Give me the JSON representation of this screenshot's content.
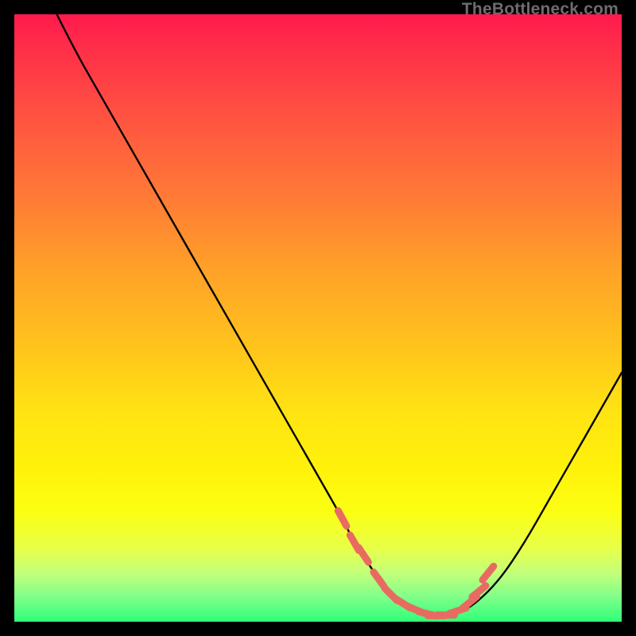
{
  "watermark": "TheBottleneck.com",
  "colors": {
    "curve": "#000000",
    "marker": "#e86b62",
    "background_top": "#ff1a4d",
    "background_bottom": "#2eff77",
    "frame": "#000000"
  },
  "chart_data": {
    "type": "line",
    "title": "",
    "xlabel": "",
    "ylabel": "",
    "xlim": [
      0,
      100
    ],
    "ylim": [
      0,
      100
    ],
    "grid": false,
    "series": [
      {
        "name": "bottleneck-curve",
        "x": [
          7,
          10,
          14,
          18,
          22,
          26,
          30,
          34,
          38,
          42,
          46,
          50,
          54,
          56,
          58,
          60,
          62,
          64,
          66,
          68,
          70,
          73,
          76,
          80,
          84,
          88,
          92,
          96,
          100
        ],
        "y": [
          100,
          94,
          87,
          80,
          73,
          66,
          59,
          52,
          45,
          38,
          31,
          24,
          17,
          13,
          10,
          7,
          4.5,
          3,
          2,
          1.3,
          1,
          1.3,
          3,
          7,
          13,
          20,
          27,
          34,
          41
        ]
      }
    ],
    "annotations": {
      "trough_markers": {
        "type": "scatter",
        "x": [
          54,
          56,
          57.5,
          60,
          62,
          64,
          66,
          68,
          69.5,
          71,
          73,
          75,
          76.5,
          78
        ],
        "y": [
          17,
          13,
          11,
          7,
          4.5,
          3,
          2,
          1.3,
          1,
          1.1,
          1.8,
          3.2,
          5,
          8
        ]
      }
    }
  }
}
